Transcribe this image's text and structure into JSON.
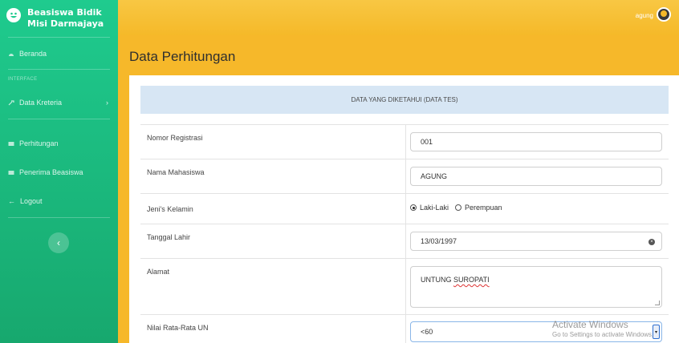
{
  "brand": {
    "line1": "Beasiswa Bidik",
    "line2": "Misi Darmajaya",
    "icon": "smile-face-icon"
  },
  "sidebar": {
    "dashboard": "Beranda",
    "heading": "INTERFACE",
    "criteria": "Data Kreteria",
    "calculation": "Perhitungan",
    "recipients": "Penerima Beasiswa",
    "logout": "Logout",
    "toggle_glyph": "‹"
  },
  "topbar": {
    "user_name": "agung"
  },
  "page": {
    "title": "Data Perhitungan"
  },
  "form": {
    "header": "DATA YANG DIKETAHUI (DATA TES)",
    "registration_label": "Nomor Registrasi",
    "registration_value": "001",
    "name_label": "Nama Mahasiswa",
    "name_value": "AGUNG",
    "gender_label": "Jeni's Kelamin",
    "gender_options": [
      "Laki-Laki",
      "Perempuan"
    ],
    "gender_selected": "Laki-Laki",
    "birthdate_label": "Tanggal Lahir",
    "birthdate_value": "13/03/1997",
    "address_label": "Alamat",
    "address_value_1": "UNTUNG ",
    "address_value_2": "SUROPATI",
    "score_label": "Nilai Rata-Rata UN",
    "score_value": "<60"
  },
  "watermark": {
    "line1": "Activate Windows",
    "line2": "Go to Settings to activate Windows."
  },
  "colors": {
    "sidebar": "#1fcb8e",
    "topbar": "#f5b929",
    "table_header": "#d7e6f4"
  }
}
